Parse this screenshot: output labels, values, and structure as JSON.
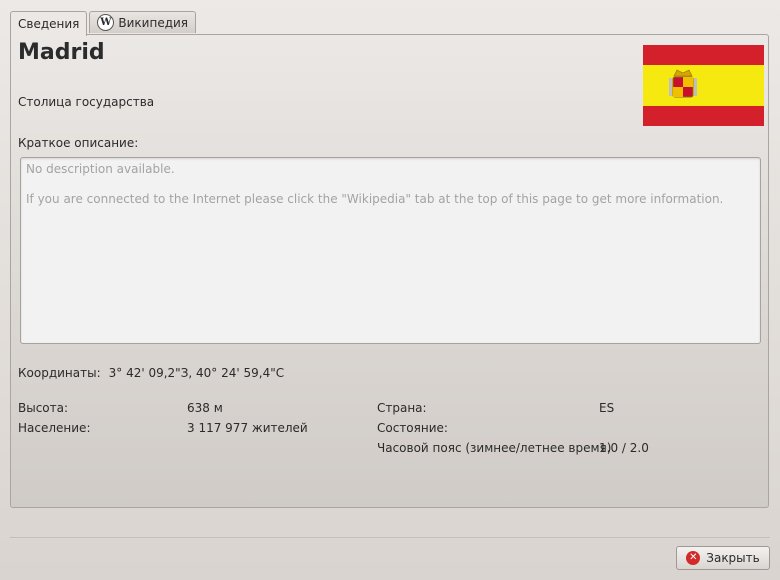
{
  "tabs": [
    {
      "label": "Сведения",
      "active": true
    },
    {
      "label": "Википедия",
      "active": false,
      "icon": "wikipedia-icon"
    }
  ],
  "city": {
    "name": "Madrid",
    "type": "Столица государства"
  },
  "flag": {
    "icon": "spain-flag",
    "colors": {
      "red": "#d4202b",
      "yellow": "#f6e90f"
    }
  },
  "description": {
    "label": "Краткое описание:",
    "lines": [
      "No description available.",
      "If you are connected to the Internet please click the \"Wikipedia\" tab at the top of this page to get more information."
    ]
  },
  "coordinates": {
    "label": "Координаты:",
    "value": "3° 42' 09,2\"З,  40° 24' 59,4\"С"
  },
  "info": {
    "elevation": {
      "label": "Высота:",
      "value": "638 м"
    },
    "population": {
      "label": "Население:",
      "value": "3 117 977 жителей"
    },
    "country": {
      "label": "Страна:",
      "value": "ES"
    },
    "state": {
      "label": "Состояние:",
      "value": ""
    },
    "timezone": {
      "label": "Часовой пояс (зимнее/летнее время)",
      "value": "1.0 / 2.0"
    }
  },
  "buttons": {
    "close": {
      "label": "Закрыть",
      "icon": "close-icon"
    }
  }
}
